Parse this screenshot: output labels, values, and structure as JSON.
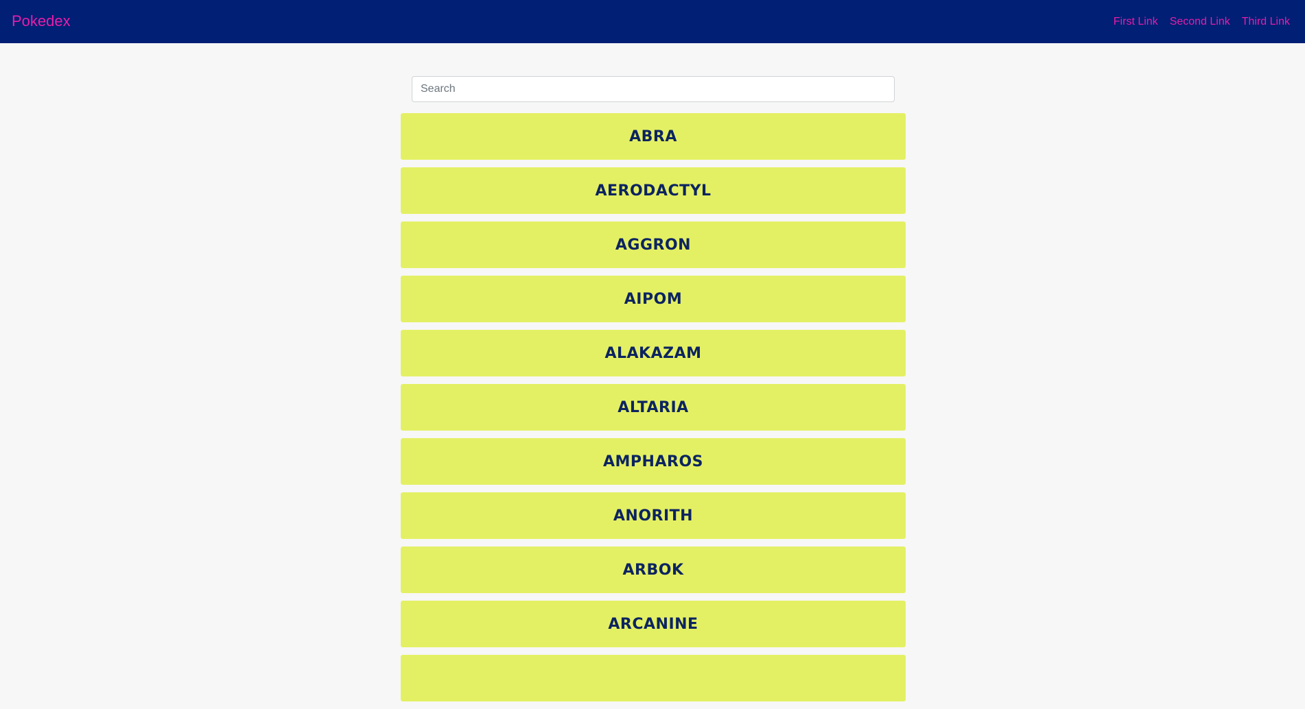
{
  "navbar": {
    "brand": "Pokedex",
    "links": [
      "First Link",
      "Second Link",
      "Third Link"
    ]
  },
  "search": {
    "placeholder": "Search",
    "value": ""
  },
  "pokemon": [
    "ABRA",
    "AERODACTYL",
    "AGGRON",
    "AIPOM",
    "ALAKAZAM",
    "ALTARIA",
    "AMPHAROS",
    "ANORITH",
    "ARBOK",
    "ARCANINE",
    ""
  ],
  "colors": {
    "navbar_bg": "#001f75",
    "accent": "#e81ea8",
    "card_bg": "#e4f064",
    "card_text": "#0c2460",
    "page_bg": "#f7f7f7"
  }
}
